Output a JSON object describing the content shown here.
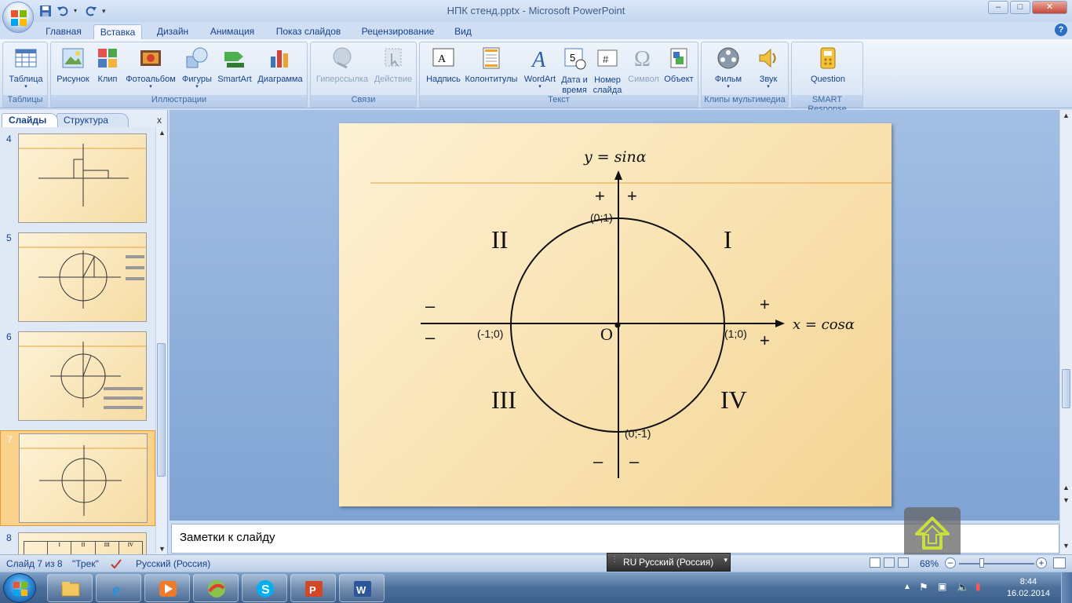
{
  "window": {
    "title": "НПК стенд.pptx - Microsoft PowerPoint",
    "buttons": {
      "minimize": "–",
      "maximize": "□",
      "close": "✕"
    }
  },
  "tabs": [
    {
      "label": "Главная"
    },
    {
      "label": "Вставка",
      "active": true
    },
    {
      "label": "Дизайн"
    },
    {
      "label": "Анимация"
    },
    {
      "label": "Показ слайдов"
    },
    {
      "label": "Рецензирование"
    },
    {
      "label": "Вид"
    }
  ],
  "ribbon": {
    "groups": [
      {
        "label": "Таблицы",
        "buttons": [
          {
            "label": "Таблица",
            "icon": "table-icon"
          }
        ]
      },
      {
        "label": "Иллюстрации",
        "buttons": [
          {
            "label": "Рисунок",
            "icon": "picture-icon"
          },
          {
            "label": "Клип",
            "icon": "clipart-icon"
          },
          {
            "label": "Фотоальбом",
            "icon": "photo-album-icon"
          },
          {
            "label": "Фигуры",
            "icon": "shapes-icon"
          },
          {
            "label": "SmartArt",
            "icon": "smartart-icon"
          },
          {
            "label": "Диаграмма",
            "icon": "chart-icon"
          }
        ]
      },
      {
        "label": "Связи",
        "buttons": [
          {
            "label": "Гиперссылка",
            "icon": "hyperlink-icon",
            "disabled": true
          },
          {
            "label": "Действие",
            "icon": "action-icon",
            "disabled": true
          }
        ]
      },
      {
        "label": "Текст",
        "buttons": [
          {
            "label": "Надпись",
            "icon": "textbox-icon"
          },
          {
            "label": "Колонтитулы",
            "icon": "header-footer-icon"
          },
          {
            "label": "WordArt",
            "icon": "wordart-icon"
          },
          {
            "label": "Дата и время",
            "icon": "date-time-icon"
          },
          {
            "label": "Номер слайда",
            "icon": "slide-number-icon"
          },
          {
            "label": "Символ",
            "icon": "symbol-icon",
            "disabled": true
          },
          {
            "label": "Объект",
            "icon": "object-icon"
          }
        ]
      },
      {
        "label": "Клипы мультимедиа",
        "buttons": [
          {
            "label": "Фильм",
            "icon": "movie-icon"
          },
          {
            "label": "Звук",
            "icon": "sound-icon"
          }
        ]
      },
      {
        "label": "SMART Response",
        "buttons": [
          {
            "label": "Question",
            "icon": "question-icon"
          }
        ]
      }
    ]
  },
  "left_panel": {
    "tabs": [
      "Слайды",
      "Структура"
    ],
    "close": "x",
    "thumbnails": [
      {
        "number": "4"
      },
      {
        "number": "5"
      },
      {
        "number": "6"
      },
      {
        "number": "7",
        "selected": true
      },
      {
        "number": "8"
      }
    ],
    "slide8_headers": [
      "I",
      "II",
      "III",
      "IV"
    ]
  },
  "slide": {
    "y_axis_label": "y = sinα",
    "x_axis_label": "x = cosα",
    "origin": "O",
    "points": {
      "top": "(0;1)",
      "bottom": "(0;-1)",
      "left": "(-1;0)",
      "right": "(1;0)"
    },
    "quadrants": {
      "q1": "I",
      "q2": "II",
      "q3": "III",
      "q4": "IV"
    },
    "signs": {
      "top_left": "+",
      "top_right": "+",
      "bottom_left": "–",
      "bottom_right": "–",
      "left_top": "–",
      "left_bottom": "–",
      "right_top": "+",
      "right_bottom": "+"
    }
  },
  "notes": {
    "placeholder": "Заметки к слайду"
  },
  "status": {
    "slide_counter": "Слайд 7 из 8",
    "theme": "\"Трек\"",
    "language": "Русский (Россия)",
    "zoom": "68%"
  },
  "language_bar": {
    "code": "RU",
    "label": "Русский (Россия)"
  },
  "taskbar": {
    "apps": [
      "explorer-icon",
      "ie-icon",
      "media-player-icon",
      "orb-icon",
      "skype-icon",
      "powerpoint-icon",
      "word-icon"
    ],
    "time": "8:44",
    "date": "16.02.2014"
  },
  "colors": {
    "accent": "#2a6fc4",
    "slide_bg": "#f9e3b3",
    "selected_thumb": "#fbd28c"
  }
}
